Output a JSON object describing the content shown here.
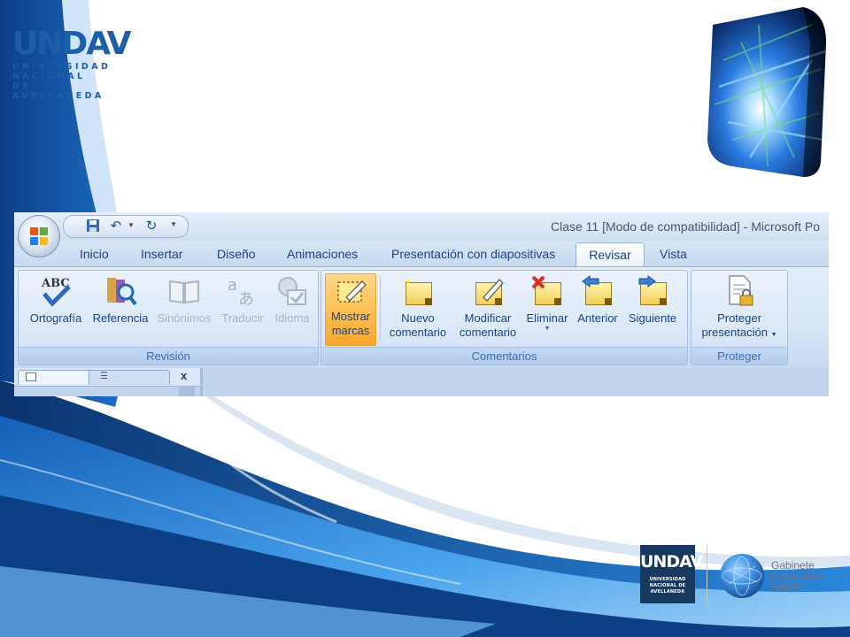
{
  "logo": {
    "brand": "UNDAV",
    "lines": [
      "UNIVERSIDAD",
      "NACIONAL DE",
      "AVELLANEDA"
    ]
  },
  "window": {
    "title": "Clase 11 [Modo de compatibilidad] - Microsoft Po"
  },
  "tabs": [
    {
      "label": "Inicio"
    },
    {
      "label": "Insertar"
    },
    {
      "label": "Diseño"
    },
    {
      "label": "Animaciones"
    },
    {
      "label": "Presentación con diapositivas"
    },
    {
      "label": "Revisar"
    },
    {
      "label": "Vista"
    }
  ],
  "active_tab": "Revisar",
  "groups": {
    "revision": {
      "label": "Revisión",
      "buttons": [
        {
          "label": "Ortografía",
          "icon": "spellcheck-icon",
          "enabled": true
        },
        {
          "label": "Referencia",
          "icon": "research-icon",
          "enabled": true
        },
        {
          "label": "Sinónimos",
          "icon": "thesaurus-icon",
          "enabled": false
        },
        {
          "label": "Traducir",
          "icon": "translate-icon",
          "enabled": false
        },
        {
          "label": "Idioma",
          "icon": "language-icon",
          "enabled": false
        }
      ]
    },
    "comentarios": {
      "label": "Comentarios",
      "buttons": [
        {
          "label_line1": "Mostrar",
          "label_line2": "marcas",
          "icon": "show-markup-icon",
          "active": true
        },
        {
          "label_line1": "Nuevo",
          "label_line2": "comentario",
          "icon": "new-comment-icon"
        },
        {
          "label_line1": "Modificar",
          "label_line2": "comentario",
          "icon": "edit-comment-icon"
        },
        {
          "label": "Eliminar",
          "icon": "delete-comment-icon",
          "has_dropdown": true
        },
        {
          "label": "Anterior",
          "icon": "previous-comment-icon"
        },
        {
          "label": "Siguiente",
          "icon": "next-comment-icon"
        }
      ]
    },
    "proteger": {
      "label": "Proteger",
      "buttons": [
        {
          "label_line1": "Proteger",
          "label_line2": "presentación",
          "icon": "protect-presentation-icon",
          "has_dropdown": true
        }
      ]
    }
  },
  "pane": {
    "close_label": "x"
  },
  "footer": {
    "brand": "UNDAV",
    "brand_lines": [
      "UNIVERSIDAD",
      "NACIONAL DE",
      "AVELLANEDA"
    ],
    "gabinete_lines": [
      "Gabinete",
      "Informático",
      "UNDAV"
    ]
  },
  "colors": {
    "accent_blue": "#1b5fa8",
    "ribbon_text": "#15428b",
    "active_button": "#ffc35a"
  }
}
